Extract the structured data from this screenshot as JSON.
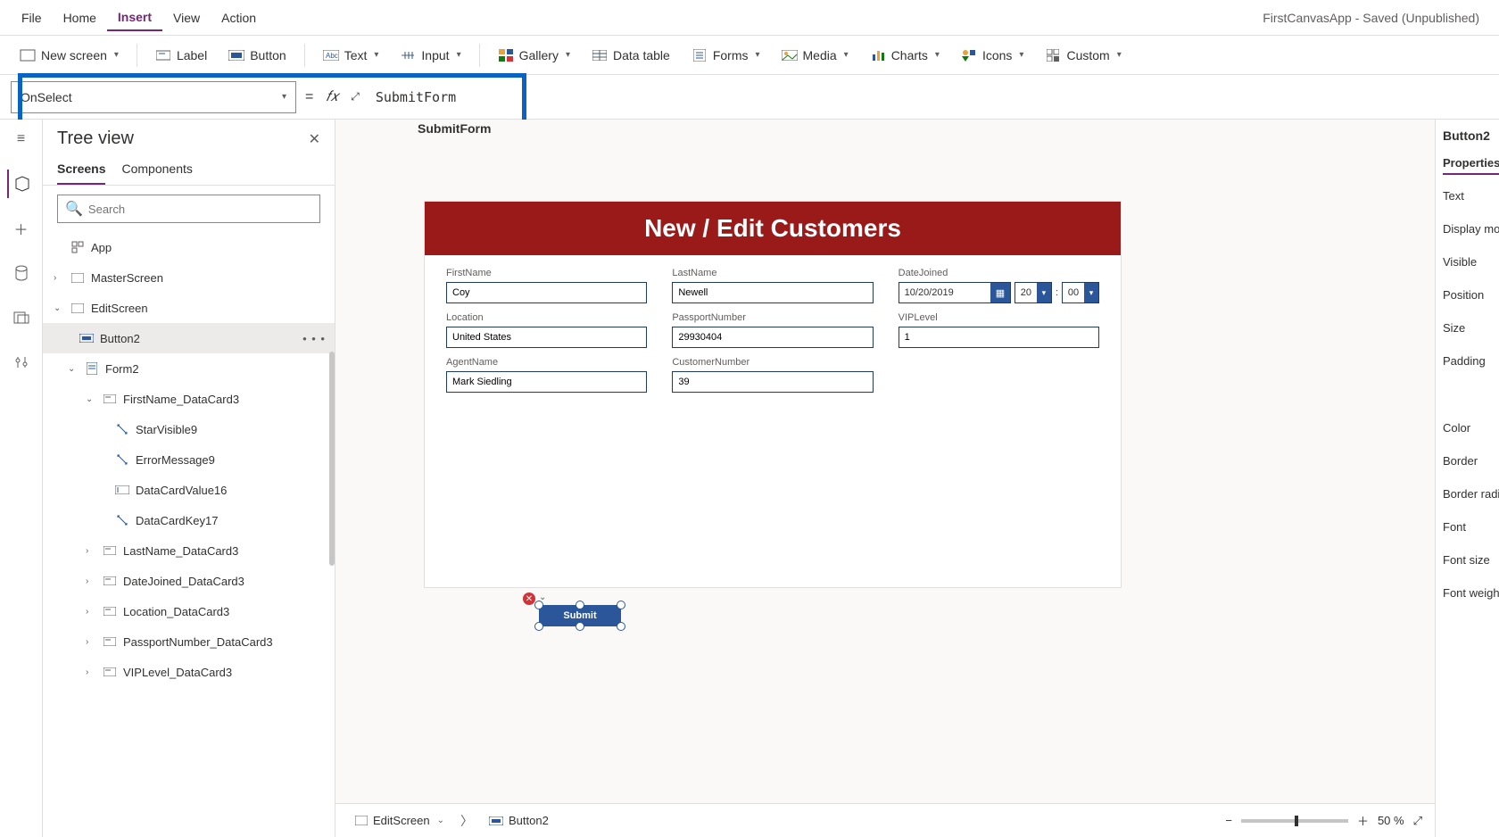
{
  "app_title": "FirstCanvasApp - Saved (Unpublished)",
  "menubar": {
    "items": [
      "File",
      "Home",
      "Insert",
      "View",
      "Action"
    ],
    "active": "Insert"
  },
  "ribbon": {
    "new_screen": "New screen",
    "label": "Label",
    "button": "Button",
    "text": "Text",
    "input": "Input",
    "gallery": "Gallery",
    "data_table": "Data table",
    "forms": "Forms",
    "media": "Media",
    "charts": "Charts",
    "icons": "Icons",
    "custom": "Custom"
  },
  "formula": {
    "property": "OnSelect",
    "equals": "=",
    "value": "SubmitForm",
    "suggestion": "SubmitForm"
  },
  "treeview": {
    "title": "Tree view",
    "tabs": {
      "screens": "Screens",
      "components": "Components"
    },
    "search_placeholder": "Search",
    "items": {
      "app": "App",
      "master": "MasterScreen",
      "edit": "EditScreen",
      "button2": "Button2",
      "form2": "Form2",
      "firstname_card": "FirstName_DataCard3",
      "starvisible9": "StarVisible9",
      "errormessage9": "ErrorMessage9",
      "datacardvalue16": "DataCardValue16",
      "datacardkey17": "DataCardKey17",
      "lastname_card": "LastName_DataCard3",
      "datejoined_card": "DateJoined_DataCard3",
      "location_card": "Location_DataCard3",
      "passport_card": "PassportNumber_DataCard3",
      "viplevel_card": "VIPLevel_DataCard3"
    }
  },
  "form": {
    "header": "New / Edit Customers",
    "fields": {
      "firstname": {
        "label": "FirstName",
        "value": "Coy"
      },
      "lastname": {
        "label": "LastName",
        "value": "Newell"
      },
      "datejoined": {
        "label": "DateJoined",
        "date": "10/20/2019",
        "hour": "20",
        "minute": "00"
      },
      "location": {
        "label": "Location",
        "value": "United States"
      },
      "passport": {
        "label": "PassportNumber",
        "value": "29930404"
      },
      "viplevel": {
        "label": "VIPLevel",
        "value": "1"
      },
      "agentname": {
        "label": "AgentName",
        "value": "Mark Siedling"
      },
      "customernumber": {
        "label": "CustomerNumber",
        "value": "39"
      }
    },
    "submit_button": "Submit"
  },
  "breadcrumb": {
    "screen": "EditScreen",
    "control": "Button2",
    "zoom": "50"
  },
  "properties": {
    "control_name": "Button2",
    "tab": "Properties",
    "rows": {
      "text": "Text",
      "display_mode": "Display mo",
      "visible": "Visible",
      "position": "Position",
      "size": "Size",
      "padding": "Padding",
      "color": "Color",
      "border": "Border",
      "border_radius": "Border radi",
      "font": "Font",
      "font_size": "Font size",
      "font_weight": "Font weigh"
    }
  }
}
